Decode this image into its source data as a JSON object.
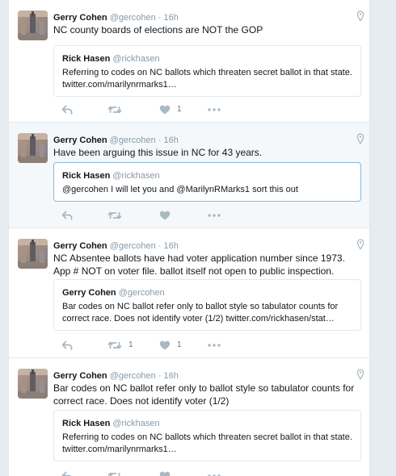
{
  "colors": {
    "muted": "#8899a6",
    "icon": "#aab8c2",
    "border": "#e1e8ed",
    "quote_focus_border": "#8ab7d8"
  },
  "tweets": [
    {
      "name": "Gerry Cohen",
      "handle": "@gercohen",
      "time": "16h",
      "text": "NC county boards of elections are NOT the GOP",
      "quote": {
        "name": "Rick Hasen",
        "handle": "@rickhasen",
        "text": "Referring to codes on NC ballots which threaten secret ballot in that state. twitter.com/marilynrmarks1…"
      },
      "retweets": "",
      "likes": "1"
    },
    {
      "name": "Gerry Cohen",
      "handle": "@gercohen",
      "time": "16h",
      "text": "Have been arguing this issue in NC for 43 years.",
      "quote": {
        "name": "Rick Hasen",
        "handle": "@rickhasen",
        "text": "@gercohen I will let you and @MarilynRMarks1 sort this out"
      },
      "retweets": "",
      "likes": ""
    },
    {
      "name": "Gerry Cohen",
      "handle": "@gercohen",
      "time": "16h",
      "text": "NC Absentee ballots have had voter application number since 1973. App # NOT on voter file. ballot itself not open to public inspection.",
      "quote": {
        "name": "Gerry Cohen",
        "handle": "@gercohen",
        "text": "Bar codes on NC ballot refer only to ballot style so tabulator counts for correct race. Does not identify voter (1/2) twitter.com/rickhasen/stat…"
      },
      "retweets": "1",
      "likes": "1"
    },
    {
      "name": "Gerry Cohen",
      "handle": "@gercohen",
      "time": "16h",
      "text": "Bar codes on NC ballot refer only to ballot style so tabulator counts for correct race. Does not identify voter (1/2)",
      "quote": {
        "name": "Rick Hasen",
        "handle": "@rickhasen",
        "text": "Referring to codes on NC ballots which threaten secret ballot in that state. twitter.com/marilynrmarks1…"
      },
      "retweets": "",
      "likes": ""
    }
  ]
}
